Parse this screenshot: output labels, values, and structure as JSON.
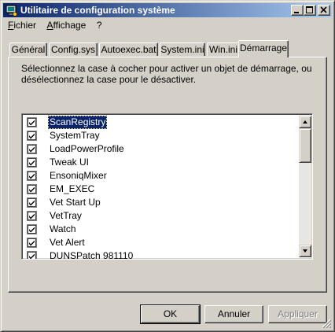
{
  "window": {
    "title": "Utilitaire de configuration système",
    "icon": "computer-icon"
  },
  "title_buttons": {
    "minimize_icon": "minimize-icon",
    "maximize_icon": "maximize-icon",
    "close_icon": "close-icon"
  },
  "menu": [
    "Fichier",
    "Affichage",
    "?"
  ],
  "tabs": [
    "Général",
    "Config.sys",
    "Autoexec.bat",
    "System.ini",
    "Win.ini",
    "Démarrage"
  ],
  "active_tab": "Démarrage",
  "description": "Sélectionnez la case à cocher pour activer un objet de démarrage, ou désélectionnez la case pour le désactiver.",
  "startup_items": [
    {
      "label": "ScanRegistry",
      "checked": true,
      "selected": true
    },
    {
      "label": "SystemTray",
      "checked": true
    },
    {
      "label": "LoadPowerProfile",
      "checked": true
    },
    {
      "label": "Tweak UI",
      "checked": true
    },
    {
      "label": "EnsoniqMixer",
      "checked": true
    },
    {
      "label": "EM_EXEC",
      "checked": true
    },
    {
      "label": "Vet Start Up",
      "checked": true
    },
    {
      "label": "VetTray",
      "checked": true
    },
    {
      "label": "Watch",
      "checked": true
    },
    {
      "label": "Vet Alert",
      "checked": true
    },
    {
      "label": "DUNSPatch 981110",
      "checked": true
    }
  ],
  "buttons": {
    "ok": "OK",
    "cancel": "Annuler",
    "apply": "Appliquer"
  },
  "colors": {
    "titlebar_start": "#0a246a",
    "titlebar_end": "#a6caf0",
    "face": "#d4d0c8",
    "selection": "#0a246a"
  }
}
